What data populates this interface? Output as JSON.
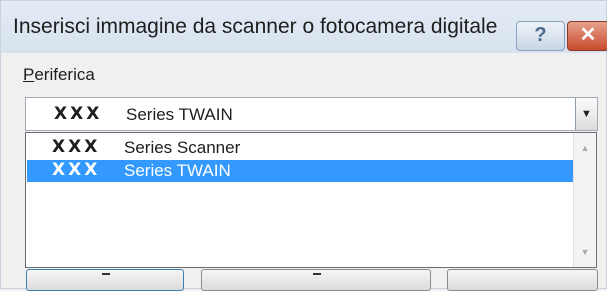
{
  "dialog": {
    "title": "Inserisci immagine da scanner o fotocamera digitale",
    "help_button": "?",
    "close_button": "✕"
  },
  "device": {
    "label_accel": "P",
    "label_rest": "eriferica",
    "selected": {
      "brand": "XXX",
      "name": "Series TWAIN"
    },
    "options": [
      {
        "brand": "XXX",
        "name": "Series Scanner",
        "selected": false
      },
      {
        "brand": "XXX",
        "name": "Series TWAIN",
        "selected": true
      }
    ]
  },
  "colors": {
    "selection": "#3399ff",
    "titlebar": "#d7e2ee",
    "close": "#c74a2d"
  },
  "icons": {
    "dropdown": "chevron-down-icon",
    "scroll_up": "scroll-up-arrow-icon",
    "scroll_down": "scroll-down-arrow-icon",
    "help": "help-icon",
    "close": "close-icon"
  }
}
